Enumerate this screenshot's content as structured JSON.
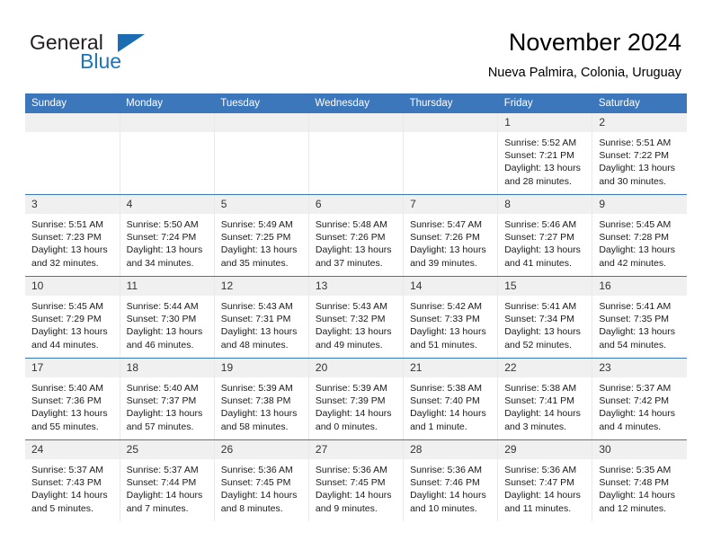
{
  "brand": {
    "name_part1": "General",
    "name_part2": "Blue",
    "logo_icon": "triangle-logo-icon",
    "accent_color": "#1b6cb0"
  },
  "header": {
    "title": "November 2024",
    "subtitle": "Nueva Palmira, Colonia, Uruguay"
  },
  "colors": {
    "header_row_bg": "#3d77bb",
    "day_number_bg": "#f0f0f0",
    "week_divider": "#3d77bb",
    "brand_blue": "#1b75bb"
  },
  "calendar": {
    "weekday_headers": [
      "Sunday",
      "Monday",
      "Tuesday",
      "Wednesday",
      "Thursday",
      "Friday",
      "Saturday"
    ],
    "labels": {
      "sunrise": "Sunrise:",
      "sunset": "Sunset:",
      "daylight": "Daylight:"
    },
    "weeks": [
      [
        {
          "day": "",
          "blank": true
        },
        {
          "day": "",
          "blank": true
        },
        {
          "day": "",
          "blank": true
        },
        {
          "day": "",
          "blank": true
        },
        {
          "day": "",
          "blank": true
        },
        {
          "day": "1",
          "sunrise": "Sunrise: 5:52 AM",
          "sunset": "Sunset: 7:21 PM",
          "daylight_line1": "Daylight: 13 hours",
          "daylight_line2": "and 28 minutes."
        },
        {
          "day": "2",
          "sunrise": "Sunrise: 5:51 AM",
          "sunset": "Sunset: 7:22 PM",
          "daylight_line1": "Daylight: 13 hours",
          "daylight_line2": "and 30 minutes."
        }
      ],
      [
        {
          "day": "3",
          "sunrise": "Sunrise: 5:51 AM",
          "sunset": "Sunset: 7:23 PM",
          "daylight_line1": "Daylight: 13 hours",
          "daylight_line2": "and 32 minutes."
        },
        {
          "day": "4",
          "sunrise": "Sunrise: 5:50 AM",
          "sunset": "Sunset: 7:24 PM",
          "daylight_line1": "Daylight: 13 hours",
          "daylight_line2": "and 34 minutes."
        },
        {
          "day": "5",
          "sunrise": "Sunrise: 5:49 AM",
          "sunset": "Sunset: 7:25 PM",
          "daylight_line1": "Daylight: 13 hours",
          "daylight_line2": "and 35 minutes."
        },
        {
          "day": "6",
          "sunrise": "Sunrise: 5:48 AM",
          "sunset": "Sunset: 7:26 PM",
          "daylight_line1": "Daylight: 13 hours",
          "daylight_line2": "and 37 minutes."
        },
        {
          "day": "7",
          "sunrise": "Sunrise: 5:47 AM",
          "sunset": "Sunset: 7:26 PM",
          "daylight_line1": "Daylight: 13 hours",
          "daylight_line2": "and 39 minutes."
        },
        {
          "day": "8",
          "sunrise": "Sunrise: 5:46 AM",
          "sunset": "Sunset: 7:27 PM",
          "daylight_line1": "Daylight: 13 hours",
          "daylight_line2": "and 41 minutes."
        },
        {
          "day": "9",
          "sunrise": "Sunrise: 5:45 AM",
          "sunset": "Sunset: 7:28 PM",
          "daylight_line1": "Daylight: 13 hours",
          "daylight_line2": "and 42 minutes."
        }
      ],
      [
        {
          "day": "10",
          "sunrise": "Sunrise: 5:45 AM",
          "sunset": "Sunset: 7:29 PM",
          "daylight_line1": "Daylight: 13 hours",
          "daylight_line2": "and 44 minutes."
        },
        {
          "day": "11",
          "sunrise": "Sunrise: 5:44 AM",
          "sunset": "Sunset: 7:30 PM",
          "daylight_line1": "Daylight: 13 hours",
          "daylight_line2": "and 46 minutes."
        },
        {
          "day": "12",
          "sunrise": "Sunrise: 5:43 AM",
          "sunset": "Sunset: 7:31 PM",
          "daylight_line1": "Daylight: 13 hours",
          "daylight_line2": "and 48 minutes."
        },
        {
          "day": "13",
          "sunrise": "Sunrise: 5:43 AM",
          "sunset": "Sunset: 7:32 PM",
          "daylight_line1": "Daylight: 13 hours",
          "daylight_line2": "and 49 minutes."
        },
        {
          "day": "14",
          "sunrise": "Sunrise: 5:42 AM",
          "sunset": "Sunset: 7:33 PM",
          "daylight_line1": "Daylight: 13 hours",
          "daylight_line2": "and 51 minutes."
        },
        {
          "day": "15",
          "sunrise": "Sunrise: 5:41 AM",
          "sunset": "Sunset: 7:34 PM",
          "daylight_line1": "Daylight: 13 hours",
          "daylight_line2": "and 52 minutes."
        },
        {
          "day": "16",
          "sunrise": "Sunrise: 5:41 AM",
          "sunset": "Sunset: 7:35 PM",
          "daylight_line1": "Daylight: 13 hours",
          "daylight_line2": "and 54 minutes."
        }
      ],
      [
        {
          "day": "17",
          "sunrise": "Sunrise: 5:40 AM",
          "sunset": "Sunset: 7:36 PM",
          "daylight_line1": "Daylight: 13 hours",
          "daylight_line2": "and 55 minutes."
        },
        {
          "day": "18",
          "sunrise": "Sunrise: 5:40 AM",
          "sunset": "Sunset: 7:37 PM",
          "daylight_line1": "Daylight: 13 hours",
          "daylight_line2": "and 57 minutes."
        },
        {
          "day": "19",
          "sunrise": "Sunrise: 5:39 AM",
          "sunset": "Sunset: 7:38 PM",
          "daylight_line1": "Daylight: 13 hours",
          "daylight_line2": "and 58 minutes."
        },
        {
          "day": "20",
          "sunrise": "Sunrise: 5:39 AM",
          "sunset": "Sunset: 7:39 PM",
          "daylight_line1": "Daylight: 14 hours",
          "daylight_line2": "and 0 minutes."
        },
        {
          "day": "21",
          "sunrise": "Sunrise: 5:38 AM",
          "sunset": "Sunset: 7:40 PM",
          "daylight_line1": "Daylight: 14 hours",
          "daylight_line2": "and 1 minute."
        },
        {
          "day": "22",
          "sunrise": "Sunrise: 5:38 AM",
          "sunset": "Sunset: 7:41 PM",
          "daylight_line1": "Daylight: 14 hours",
          "daylight_line2": "and 3 minutes."
        },
        {
          "day": "23",
          "sunrise": "Sunrise: 5:37 AM",
          "sunset": "Sunset: 7:42 PM",
          "daylight_line1": "Daylight: 14 hours",
          "daylight_line2": "and 4 minutes."
        }
      ],
      [
        {
          "day": "24",
          "sunrise": "Sunrise: 5:37 AM",
          "sunset": "Sunset: 7:43 PM",
          "daylight_line1": "Daylight: 14 hours",
          "daylight_line2": "and 5 minutes."
        },
        {
          "day": "25",
          "sunrise": "Sunrise: 5:37 AM",
          "sunset": "Sunset: 7:44 PM",
          "daylight_line1": "Daylight: 14 hours",
          "daylight_line2": "and 7 minutes."
        },
        {
          "day": "26",
          "sunrise": "Sunrise: 5:36 AM",
          "sunset": "Sunset: 7:45 PM",
          "daylight_line1": "Daylight: 14 hours",
          "daylight_line2": "and 8 minutes."
        },
        {
          "day": "27",
          "sunrise": "Sunrise: 5:36 AM",
          "sunset": "Sunset: 7:45 PM",
          "daylight_line1": "Daylight: 14 hours",
          "daylight_line2": "and 9 minutes."
        },
        {
          "day": "28",
          "sunrise": "Sunrise: 5:36 AM",
          "sunset": "Sunset: 7:46 PM",
          "daylight_line1": "Daylight: 14 hours",
          "daylight_line2": "and 10 minutes."
        },
        {
          "day": "29",
          "sunrise": "Sunrise: 5:36 AM",
          "sunset": "Sunset: 7:47 PM",
          "daylight_line1": "Daylight: 14 hours",
          "daylight_line2": "and 11 minutes."
        },
        {
          "day": "30",
          "sunrise": "Sunrise: 5:35 AM",
          "sunset": "Sunset: 7:48 PM",
          "daylight_line1": "Daylight: 14 hours",
          "daylight_line2": "and 12 minutes."
        }
      ]
    ]
  }
}
